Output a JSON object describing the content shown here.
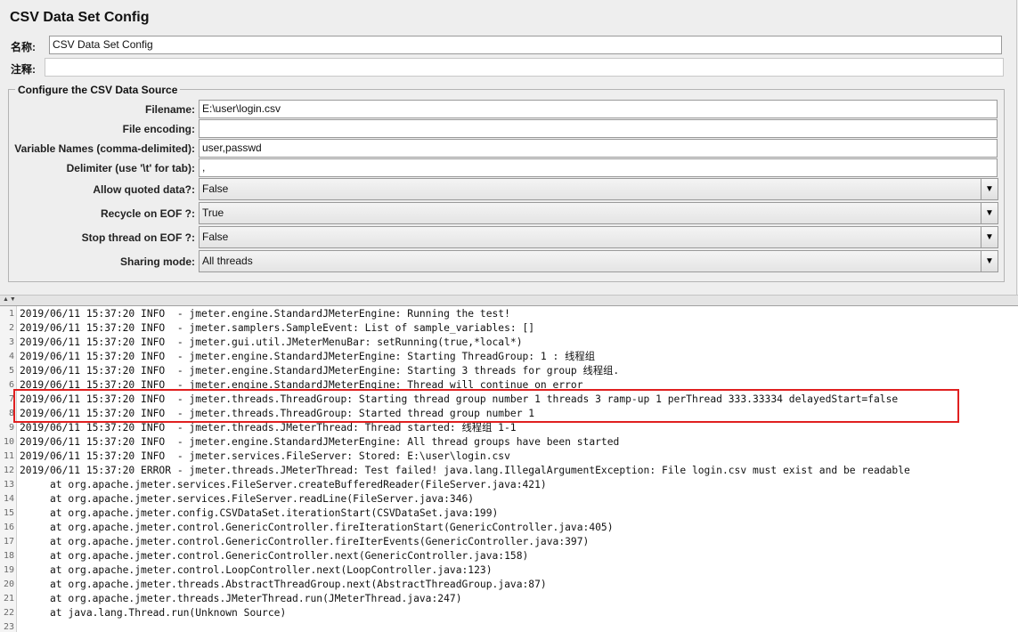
{
  "header": {
    "title": "CSV Data Set Config"
  },
  "name_row": {
    "label": "名称:",
    "value": "CSV Data Set Config"
  },
  "comment_row": {
    "label": "注释:",
    "value": ""
  },
  "section": {
    "title": "Configure the CSV Data Source",
    "fields": [
      {
        "label": "Filename:",
        "value": "E:\\user\\login.csv"
      },
      {
        "label": "File encoding:",
        "value": ""
      },
      {
        "label": "Variable Names (comma-delimited):",
        "value": "user,passwd"
      },
      {
        "label": "Delimiter (use '\\t' for tab):",
        "value": ","
      }
    ],
    "combos": [
      {
        "label": "Allow quoted data?:",
        "value": "False"
      },
      {
        "label": "Recycle on EOF ?:",
        "value": "True"
      },
      {
        "label": "Stop thread on EOF ?:",
        "value": "False"
      },
      {
        "label": "Sharing mode:",
        "value": "All threads"
      }
    ]
  },
  "log": {
    "lines": [
      {
        "n": "1",
        "text": "2019/06/11 15:37:20 INFO  - jmeter.engine.StandardJMeterEngine: Running the test!"
      },
      {
        "n": "2",
        "text": "2019/06/11 15:37:20 INFO  - jmeter.samplers.SampleEvent: List of sample_variables: []"
      },
      {
        "n": "3",
        "text": "2019/06/11 15:37:20 INFO  - jmeter.gui.util.JMeterMenuBar: setRunning(true,*local*)"
      },
      {
        "n": "4",
        "text": "2019/06/11 15:37:20 INFO  - jmeter.engine.StandardJMeterEngine: Starting ThreadGroup: 1 : 线程组"
      },
      {
        "n": "5",
        "text": "2019/06/11 15:37:20 INFO  - jmeter.engine.StandardJMeterEngine: Starting 3 threads for group 线程组."
      },
      {
        "n": "6",
        "text": "2019/06/11 15:37:20 INFO  - jmeter.engine.StandardJMeterEngine: Thread will continue on error"
      },
      {
        "n": "7",
        "text": "2019/06/11 15:37:20 INFO  - jmeter.threads.ThreadGroup: Starting thread group number 1 threads 3 ramp-up 1 perThread 333.33334 delayedStart=false"
      },
      {
        "n": "8",
        "text": "2019/06/11 15:37:20 INFO  - jmeter.threads.ThreadGroup: Started thread group number 1"
      },
      {
        "n": "9",
        "text": "2019/06/11 15:37:20 INFO  - jmeter.threads.JMeterThread: Thread started: 线程组 1-1"
      },
      {
        "n": "10",
        "text": "2019/06/11 15:37:20 INFO  - jmeter.engine.StandardJMeterEngine: All thread groups have been started"
      },
      {
        "n": "11",
        "text": "2019/06/11 15:37:20 INFO  - jmeter.services.FileServer: Stored: E:\\user\\login.csv"
      },
      {
        "n": "12",
        "text": "2019/06/11 15:37:20 ERROR - jmeter.threads.JMeterThread: Test failed! java.lang.IllegalArgumentException: File login.csv must exist and be readable"
      },
      {
        "n": "13",
        "text": "     at org.apache.jmeter.services.FileServer.createBufferedReader(FileServer.java:421)"
      },
      {
        "n": "14",
        "text": "     at org.apache.jmeter.services.FileServer.readLine(FileServer.java:346)"
      },
      {
        "n": "15",
        "text": "     at org.apache.jmeter.config.CSVDataSet.iterationStart(CSVDataSet.java:199)"
      },
      {
        "n": "16",
        "text": "     at org.apache.jmeter.control.GenericController.fireIterationStart(GenericController.java:405)"
      },
      {
        "n": "17",
        "text": "     at org.apache.jmeter.control.GenericController.fireIterEvents(GenericController.java:397)"
      },
      {
        "n": "18",
        "text": "     at org.apache.jmeter.control.GenericController.next(GenericController.java:158)"
      },
      {
        "n": "19",
        "text": "     at org.apache.jmeter.control.LoopController.next(LoopController.java:123)"
      },
      {
        "n": "20",
        "text": "     at org.apache.jmeter.threads.AbstractThreadGroup.next(AbstractThreadGroup.java:87)"
      },
      {
        "n": "21",
        "text": "     at org.apache.jmeter.threads.JMeterThread.run(JMeterThread.java:247)"
      },
      {
        "n": "22",
        "text": "     at java.lang.Thread.run(Unknown Source)"
      },
      {
        "n": "23",
        "text": ""
      }
    ]
  },
  "colors": {
    "highlight_border": "#e02020",
    "panel_bg": "#eeeeee"
  }
}
